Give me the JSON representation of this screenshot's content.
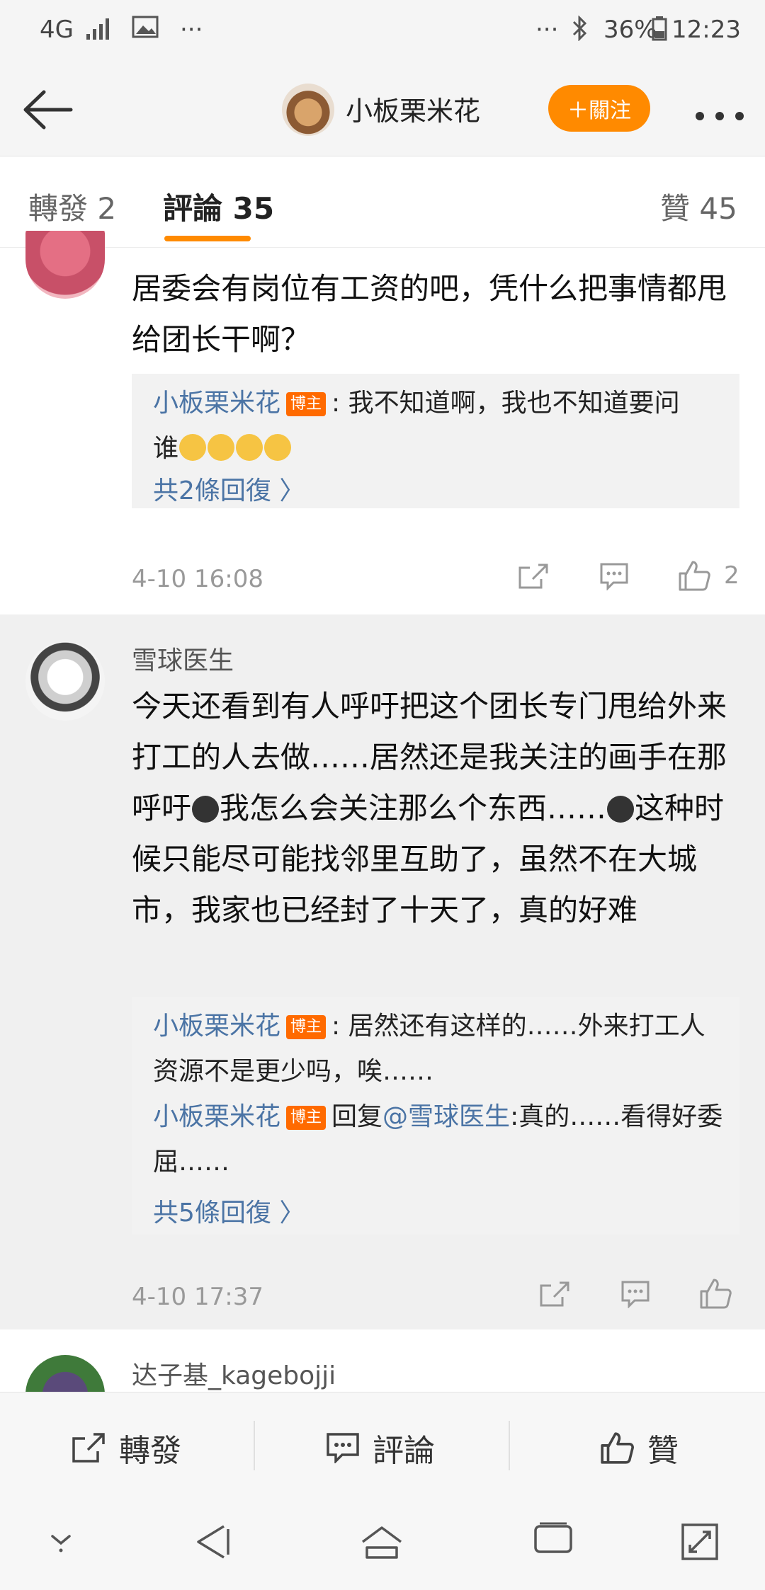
{
  "status_bar": {
    "network": "4G",
    "dots_left": "···",
    "dots_right": "···",
    "battery": "36%",
    "time": "12:23"
  },
  "header": {
    "title": "小板栗米花",
    "follow_label": "＋關注"
  },
  "tabs": {
    "repost": "轉發 2",
    "comments": "評論 35",
    "likes": "贊 45"
  },
  "comments": [
    {
      "text": "居委会有岗位有工资的吧，凭什么把事情都甩给团长干啊？",
      "reply": {
        "name": "小板栗米花",
        "badge": "博主",
        "text_line1": ": 我不知道啊，我也不知道要问",
        "text_line2": "谁"
      },
      "more_replies": "共2條回復 〉",
      "time": "4-10 16:08",
      "like_count": "2"
    },
    {
      "user": "雪球医生",
      "text_part1": "今天还看到有人呼吁把这个团长专门甩给外来打工的人去做……居然还是我关注的画手在那呼吁",
      "text_part2": "我怎么会关注那么个东西……",
      "text_part3": "这种时候只能尽可能找邻里互助了，虽然不在大城市，我家也已经封了十天了，真的好难",
      "reply1": {
        "name": "小板栗米花",
        "badge": "博主",
        "text": ": 居然还有这样的……外来打工人资源不是更少吗，唉……"
      },
      "reply2": {
        "name": "小板栗米花",
        "badge": "博主",
        "prefix": "回复",
        "at": "@雪球医生",
        "text": ":真的……看得好委屈……"
      },
      "more_replies": "共5條回復 〉",
      "time": "4-10 17:37"
    },
    {
      "user": "达子基_kagebojji"
    }
  ],
  "toolbar": {
    "repost": "轉發",
    "comment": "評論",
    "like": "贊"
  },
  "icons": {
    "back": "back-arrow-icon",
    "more": "more-icon",
    "share": "share-icon",
    "comment": "comment-icon",
    "like": "thumbs-up-icon",
    "emoji_cry": "crying-emoji-icon"
  },
  "colors": {
    "accent": "#ff8a00",
    "link": "#4b74a5",
    "badge": "#ff6a00"
  }
}
